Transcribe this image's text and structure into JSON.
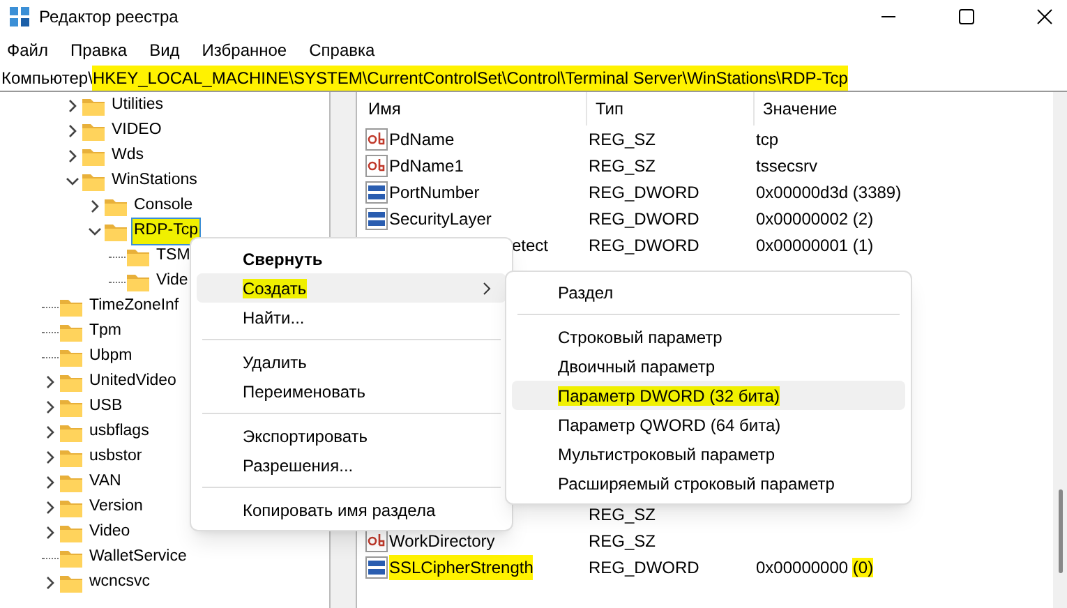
{
  "window": {
    "title": "Редактор реестра"
  },
  "menu_bar": [
    {
      "label": "Файл"
    },
    {
      "label": "Правка"
    },
    {
      "label": "Вид"
    },
    {
      "label": "Избранное"
    },
    {
      "label": "Справка"
    }
  ],
  "address_bar": {
    "prefix": "Компьютер\\",
    "path": "HKEY_LOCAL_MACHINE\\SYSTEM\\CurrentControlSet\\Control\\Terminal Server\\WinStations\\RDP-Tcp",
    "path_highlighted": true
  },
  "tree": {
    "nested_items": [
      {
        "label": "Utilities",
        "kind": "branch",
        "expanded": false,
        "selected": false,
        "highlighted": false
      },
      {
        "label": "VIDEO",
        "kind": "branch",
        "expanded": false,
        "selected": false,
        "highlighted": false
      },
      {
        "label": "Wds",
        "kind": "branch",
        "expanded": false,
        "selected": false,
        "highlighted": false
      },
      {
        "label": "WinStations",
        "kind": "branch",
        "expanded": true,
        "selected": false,
        "highlighted": false,
        "children": [
          {
            "label": "Console",
            "kind": "branch",
            "expanded": false,
            "selected": false,
            "highlighted": false
          },
          {
            "label": "RDP-Tcp",
            "kind": "branch",
            "expanded": true,
            "selected": true,
            "highlighted": true,
            "children": [
              {
                "label": "TSM",
                "kind": "leaf",
                "selected": false,
                "highlighted": false
              },
              {
                "label": "Vide",
                "kind": "leaf",
                "selected": false,
                "highlighted": false
              }
            ]
          }
        ]
      }
    ],
    "items": [
      {
        "label": "TimeZoneInf",
        "kind": "leaf",
        "selected": false,
        "highlighted": false
      },
      {
        "label": "Tpm",
        "kind": "leaf",
        "selected": false,
        "highlighted": false
      },
      {
        "label": "Ubpm",
        "kind": "leaf",
        "selected": false,
        "highlighted": false
      },
      {
        "label": "UnitedVideo",
        "kind": "branch",
        "expanded": false,
        "selected": false,
        "highlighted": false
      },
      {
        "label": "USB",
        "kind": "branch",
        "expanded": false,
        "selected": false,
        "highlighted": false
      },
      {
        "label": "usbflags",
        "kind": "branch",
        "expanded": false,
        "selected": false,
        "highlighted": false
      },
      {
        "label": "usbstor",
        "kind": "branch",
        "expanded": false,
        "selected": false,
        "highlighted": false
      },
      {
        "label": "VAN",
        "kind": "branch",
        "expanded": false,
        "selected": false,
        "highlighted": false
      },
      {
        "label": "Version",
        "kind": "branch",
        "expanded": false,
        "selected": false,
        "highlighted": false
      },
      {
        "label": "Video",
        "kind": "branch",
        "expanded": false,
        "selected": false,
        "highlighted": false
      },
      {
        "label": "WalletService",
        "kind": "leaf",
        "selected": false,
        "highlighted": false
      },
      {
        "label": "wcncsvc",
        "kind": "branch",
        "expanded": false,
        "selected": false,
        "highlighted": false
      }
    ]
  },
  "values_list": {
    "columns": [
      "Имя",
      "Тип",
      "Значение"
    ],
    "rows": [
      {
        "name": "PdName",
        "type": "REG_SZ",
        "value": "tcp",
        "kind": "string",
        "highlighted": false
      },
      {
        "name": "PdName1",
        "type": "REG_SZ",
        "value": "tssecsrv",
        "kind": "string",
        "highlighted": false
      },
      {
        "name": "PortNumber",
        "type": "REG_DWORD",
        "value": "0x00000d3d (3389)",
        "kind": "dword",
        "highlighted": false
      },
      {
        "name": "SecurityLayer",
        "type": "REG_DWORD",
        "value": "0x00000002 (2)",
        "kind": "dword",
        "highlighted": false
      },
      {
        "name": "etect",
        "type": "REG_DWORD",
        "value": "0x00000001 (1)",
        "kind": "partial",
        "highlighted": false
      },
      {
        "type": "REG_SZ",
        "kind": "hidden",
        "highlighted": false
      },
      {
        "name": "WorkDirectory",
        "type": "REG_SZ",
        "value": "",
        "kind": "string",
        "highlighted": false
      },
      {
        "name": "SSLCipherStrength",
        "type": "REG_DWORD",
        "value": "0x00000000",
        "value_mark": "(0)",
        "kind": "dword",
        "highlighted": true
      }
    ]
  },
  "context_menu": {
    "items": [
      {
        "label": "Свернуть",
        "kind": "default",
        "hovered": false,
        "highlighted": false
      },
      {
        "label": "Создать",
        "kind": "submenu",
        "hovered": true,
        "highlighted": true
      },
      {
        "label": "Найти...",
        "kind": "item",
        "hovered": false,
        "highlighted": false
      },
      {
        "kind": "separator"
      },
      {
        "label": "Удалить",
        "kind": "item",
        "hovered": false,
        "highlighted": false
      },
      {
        "label": "Переименовать",
        "kind": "item",
        "hovered": false,
        "highlighted": false
      },
      {
        "kind": "separator"
      },
      {
        "label": "Экспортировать",
        "kind": "item",
        "hovered": false,
        "highlighted": false
      },
      {
        "label": "Разрешения...",
        "kind": "item",
        "hovered": false,
        "highlighted": false
      },
      {
        "kind": "separator"
      },
      {
        "label": "Копировать имя раздела",
        "kind": "item",
        "hovered": false,
        "highlighted": false
      }
    ]
  },
  "submenu": {
    "items": [
      {
        "label": "Раздел",
        "kind": "item",
        "hovered": false,
        "highlighted": false
      },
      {
        "kind": "separator"
      },
      {
        "label": "Строковый параметр",
        "kind": "item",
        "hovered": false,
        "highlighted": false
      },
      {
        "label": "Двоичный параметр",
        "kind": "item",
        "hovered": false,
        "highlighted": false
      },
      {
        "label": "Параметр DWORD (32 бита)",
        "kind": "item",
        "hovered": true,
        "highlighted": true
      },
      {
        "label": "Параметр QWORD (64 бита)",
        "kind": "item",
        "hovered": false,
        "highlighted": false
      },
      {
        "label": "Мультистроковый параметр",
        "kind": "item",
        "hovered": false,
        "highlighted": false
      },
      {
        "label": "Расширяемый строковый параметр",
        "kind": "item",
        "hovered": false,
        "highlighted": false
      }
    ]
  }
}
